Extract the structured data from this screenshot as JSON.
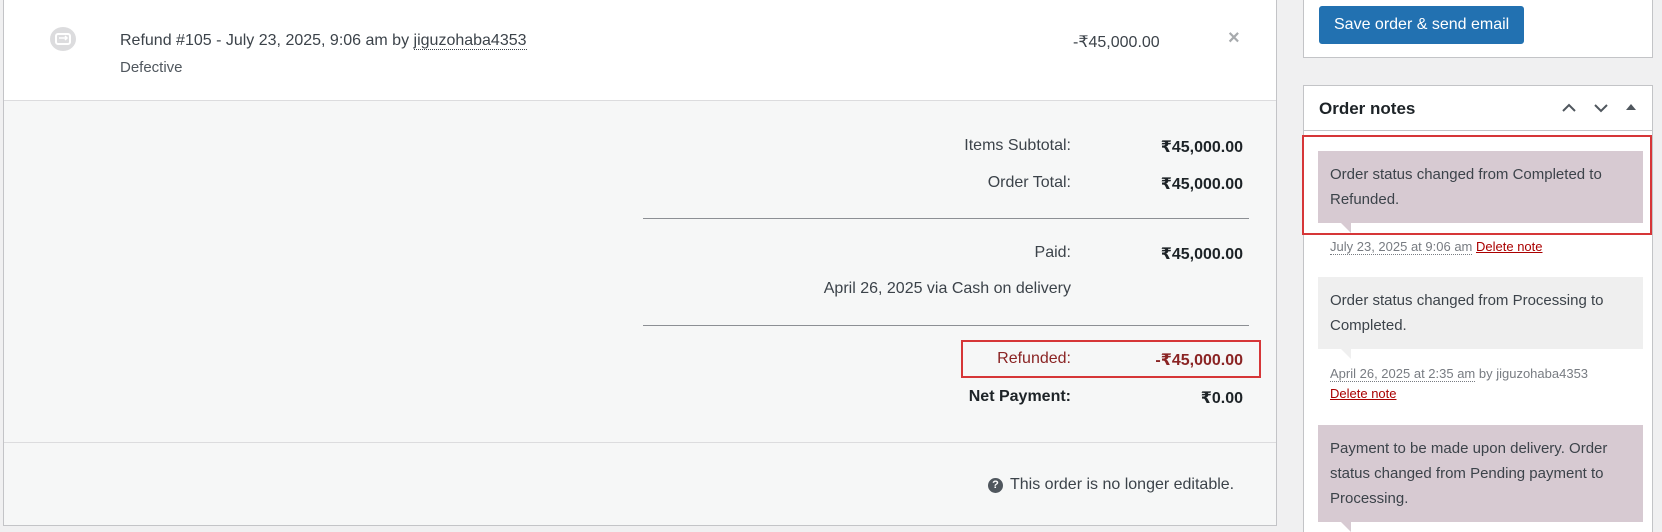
{
  "refund": {
    "title_prefix": "Refund #105 - July 23, 2025, 9:06 am by ",
    "user": "jiguzohaba4353",
    "reason": "Defective",
    "amount": "-₹45,000.00",
    "delete_glyph": "×"
  },
  "totals": {
    "items_subtotal_label": "Items Subtotal:",
    "items_subtotal_value": "₹45,000.00",
    "order_total_label": "Order Total:",
    "order_total_value": "₹45,000.00",
    "paid_label": "Paid:",
    "paid_value": "₹45,000.00",
    "paid_detail": "April 26, 2025 via Cash on delivery",
    "refunded_label": "Refunded:",
    "refunded_value": "-₹45,000.00",
    "net_label": "Net Payment:",
    "net_value": "₹0.00"
  },
  "footer": {
    "help_glyph": "?",
    "not_editable": "This order is no longer editable."
  },
  "actions": {
    "save_label": "Save order & send email"
  },
  "order_notes": {
    "title": "Order notes",
    "notes": [
      {
        "text": "Order status changed from Completed to Refunded.",
        "date": "July 23, 2025 at 9:06 am",
        "by": "",
        "delete_label": "Delete note"
      },
      {
        "text": "Order status changed from Processing to Completed.",
        "date": "April 26, 2025 at 2:35 am",
        "by": " by jiguzohaba4353",
        "delete_label": "Delete note"
      },
      {
        "text": "Payment to be made upon delivery. Order status changed from Pending payment to Processing.",
        "date": "",
        "by": "",
        "delete_label": ""
      }
    ]
  },
  "colors": {
    "primary": "#2271b1",
    "refund_red": "#8a2424",
    "highlight": "#d63638",
    "system_note": "#d7cad2",
    "plain_note": "#efefef"
  }
}
